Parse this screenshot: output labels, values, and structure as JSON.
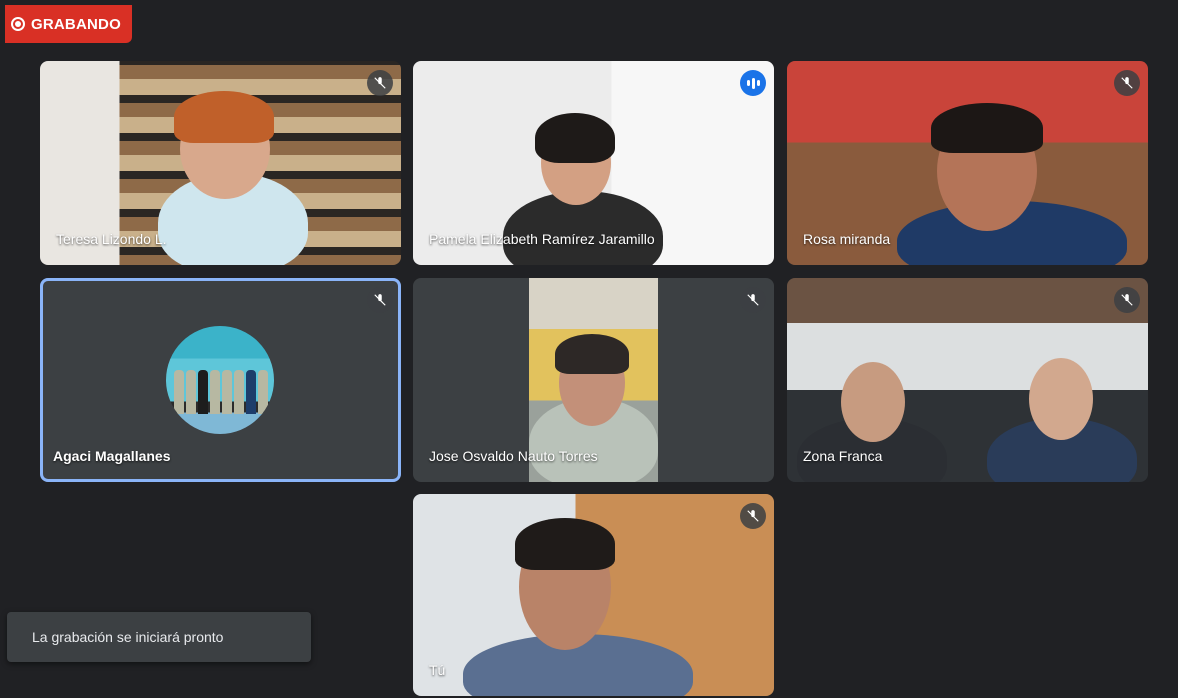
{
  "recording": {
    "label": "GRABANDO"
  },
  "toast": {
    "message": "La grabación se iniciará pronto"
  },
  "participants": [
    {
      "name": "Teresa Lizondo L.",
      "muted": true
    },
    {
      "name": "Pamela Elizabeth Ramírez Jaramillo",
      "muted": false,
      "speaking": true
    },
    {
      "name": "Rosa miranda",
      "muted": true
    },
    {
      "name": "Agaci Magallanes",
      "muted": true,
      "pinned": true
    },
    {
      "name": "Jose Osvaldo Nauto Torres",
      "muted": true
    },
    {
      "name": "Zona Franca",
      "muted": true
    },
    {
      "name": "Tú",
      "muted": true
    }
  ],
  "colors": {
    "recording": "#d93025",
    "background": "#202124",
    "tile": "#3c4043",
    "highlight": "#8ab4f8",
    "speaking": "#1a73e8"
  },
  "icons": {
    "muted": "mic-off-icon",
    "speaking": "audio-level-icon",
    "recording": "record-icon"
  }
}
